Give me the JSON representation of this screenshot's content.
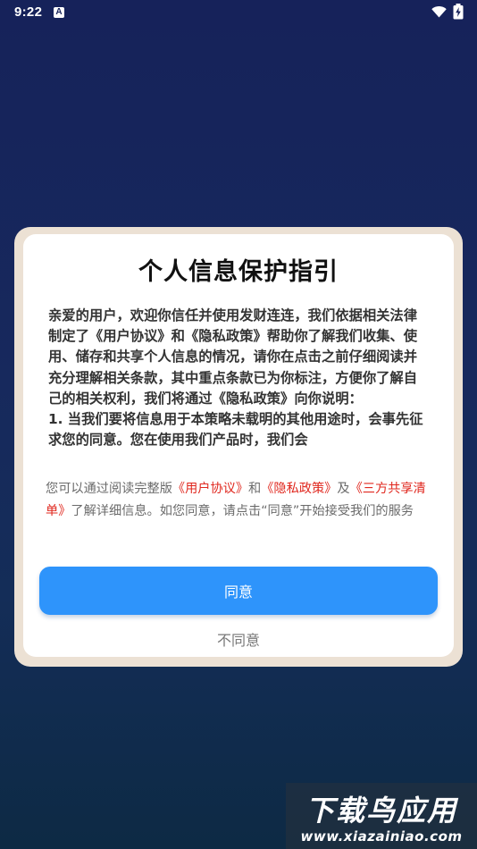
{
  "status_bar": {
    "time": "9:22",
    "notification_glyph": "A",
    "icons": [
      "wifi-icon",
      "battery-charging-icon"
    ]
  },
  "dialog": {
    "title": "个人信息保护指引",
    "policy_paragraphs": [
      "亲爱的用户，欢迎你信任并使用发财连连，我们依据相关法律制定了《用户协议》和《隐私政策》帮助你了解我们收集、使用、储存和共享个人信息的情况，请你在点击之前仔细阅读并充分理解相关条款，其中重点条款已为你标注，方便你了解自己的相关权利，我们将通过《隐私政策》向你说明：",
      "1. 当我们要将信息用于本策略未载明的其他用途时，会事先征求您的同意。您在使用我们产品时，我们会"
    ],
    "notice": {
      "prefix": "您可以通过阅读完整版",
      "link_user_agreement": "《用户协议》",
      "and": "和",
      "link_privacy_policy": "《隐私政策》",
      "and2": "及",
      "link_third_party": "《三方共享清单》",
      "suffix": "了解详细信息。如您同意，请点击“同意”开始接受我们的服务"
    },
    "agree_label": "同意",
    "disagree_label": "不同意"
  },
  "watermark": {
    "logo": "下载鸟应用",
    "url": "www.xiazainiao.com"
  },
  "colors": {
    "background_top": "#16225a",
    "background_bottom": "#0d2a44",
    "dialog_frame": "#ece1d4",
    "primary_button": "#2e94fb",
    "link": "#e0281f",
    "body_text": "#333333",
    "muted_text": "#6b6b6b"
  }
}
